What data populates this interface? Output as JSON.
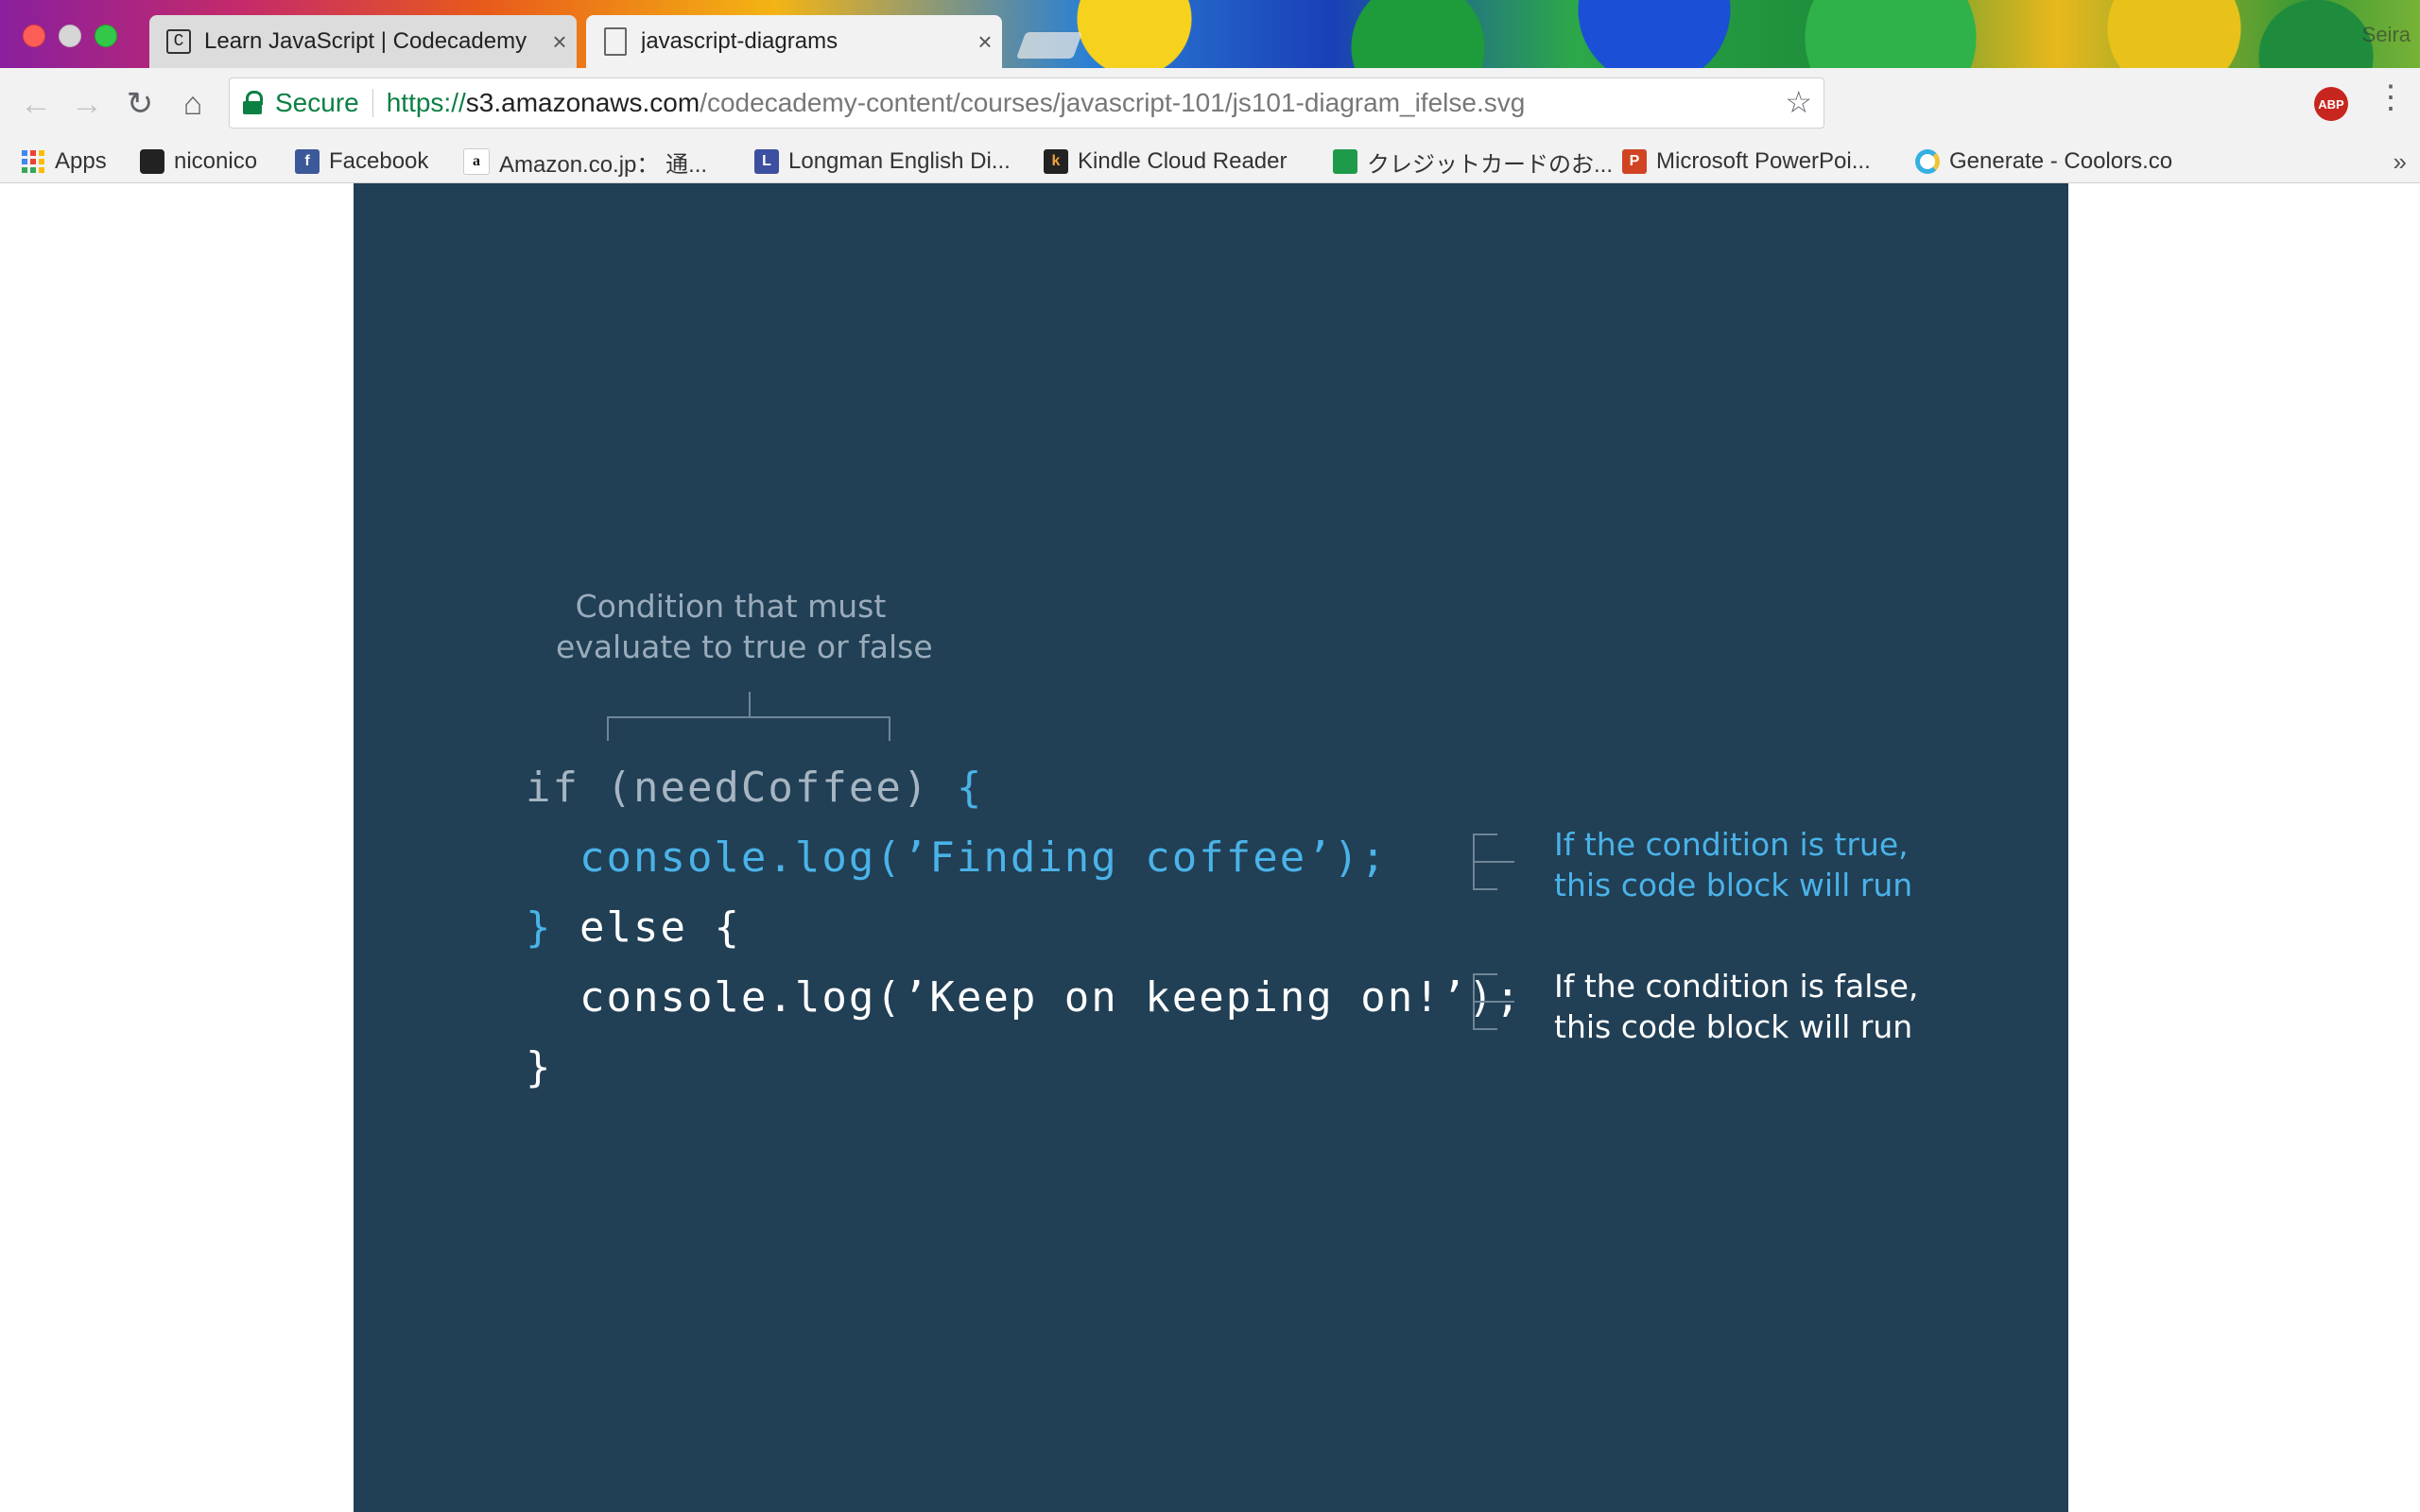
{
  "browser": {
    "tabs": [
      {
        "title": "Learn JavaScript | Codecademy",
        "active": false,
        "favicon": "codecademy-icon"
      },
      {
        "title": "javascript-diagrams",
        "active": true,
        "favicon": "document-icon"
      }
    ],
    "profile_label": "Seira",
    "toolbar": {
      "secure_label": "Secure",
      "url": {
        "scheme": "https://",
        "host": "s3.amazonaws.com",
        "path": "/codecademy-content/courses/javascript-101/js101-diagram_ifelse.svg"
      },
      "extension_label": "ABP"
    },
    "bookmarks": [
      {
        "label": "Apps",
        "icon": "apps-grid-icon"
      },
      {
        "label": "niconico",
        "icon": "niconico-icon"
      },
      {
        "label": "Facebook",
        "icon": "facebook-icon"
      },
      {
        "label": "Amazon.co.jp： 通...",
        "icon": "amazon-icon"
      },
      {
        "label": "Longman English Di...",
        "icon": "longman-icon"
      },
      {
        "label": "Kindle Cloud Reader",
        "icon": "kindle-icon"
      },
      {
        "label": "クレジットカードのお...",
        "icon": "card-icon"
      },
      {
        "label": "Microsoft PowerPoi...",
        "icon": "powerpoint-icon"
      },
      {
        "label": "Generate - Coolors.co",
        "icon": "coolors-icon"
      }
    ],
    "bookmarks_overflow": "»"
  },
  "diagram": {
    "background": "#213f55",
    "colors": {
      "keyword": "#a6b5c2",
      "accent": "#4ab3e8",
      "text": "#ffffff"
    },
    "annotation_condition": [
      "Condition that must",
      "evaluate to true or false"
    ],
    "code": {
      "line1_head": "if (needCoffee) ",
      "line1_brace": "{",
      "line2": "  console.log(’Finding coffee’);",
      "line3_brace": "}",
      "line3_tail": " else {",
      "line4": "  console.log(’Keep on keeping on!’);",
      "line5": "}"
    },
    "annotation_true": [
      "If the condition is true,",
      "this code block will run"
    ],
    "annotation_false": [
      "If the condition is false,",
      "this code block will run"
    ]
  }
}
